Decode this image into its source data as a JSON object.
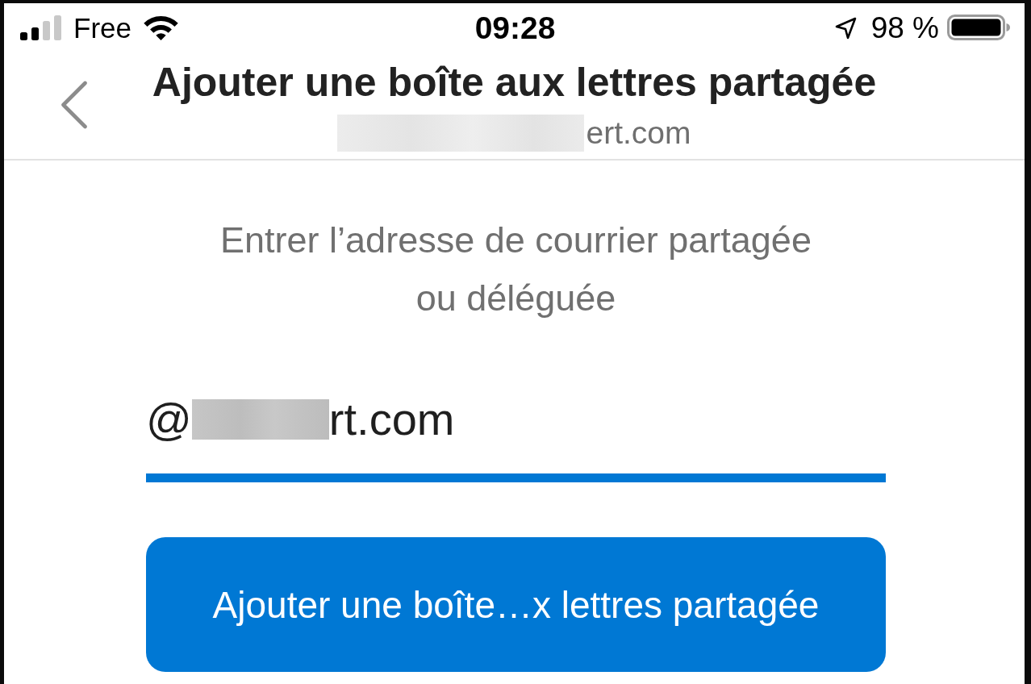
{
  "status_bar": {
    "carrier": "Free",
    "time": "09:28",
    "battery_percent": "98 %"
  },
  "header": {
    "title": "Ajouter une boîte aux lettres partagée",
    "subtitle": {
      "text": "ert.com",
      "redacted": true
    }
  },
  "prompt": "Entrer l’adresse de courrier partagée\nou déléguée",
  "email_field": {
    "value_start": "@",
    "value_end": "rt.com",
    "redacted": true,
    "focused": true
  },
  "submit_button": {
    "label": "Ajouter une boîte…x lettres partagée"
  }
}
